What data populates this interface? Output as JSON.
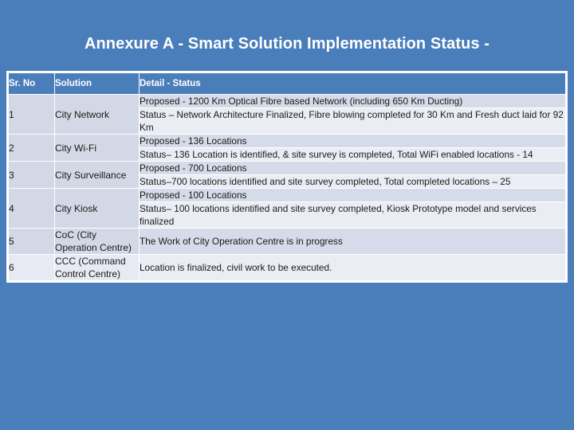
{
  "slide": {
    "title": "Annexure A - Smart Solution Implementation Status -",
    "background_color": "#4a7ebb"
  },
  "table": {
    "headers": {
      "sr_no": "Sr. No",
      "solution": "Solution",
      "detail_status": "Detail - Status"
    },
    "header_background": "#4a7ebb",
    "header_text_color": "#ffffff",
    "rows": [
      {
        "sr_no": "1",
        "solution": "City Network",
        "proposed": "Proposed - 1200 Km Optical Fibre based Network (including  650 Km Ducting)",
        "status": "Status –  Network Architecture Finalized, Fibre blowing completed for 30 Km  and Fresh duct laid for 92 Km"
      },
      {
        "sr_no": "2",
        "solution": "City Wi-Fi",
        "proposed": "Proposed - 136 Locations",
        "status": "Status– 136 Location is identified, & site survey is completed, Total  WiFi enabled locations - 14"
      },
      {
        "sr_no": "3",
        "solution": "City Surveillance",
        "proposed": "Proposed - 700 Locations",
        "status": "Status–700 locations identified and site survey completed, Total completed locations – 25"
      },
      {
        "sr_no": "4",
        "solution": "City Kiosk",
        "proposed": "Proposed - 100 Locations",
        "status": "Status– 100 locations identified and site survey completed, Kiosk Prototype model and services finalized"
      },
      {
        "sr_no": "5",
        "solution": "CoC (City Operation Centre)",
        "detail": "The Work of City Operation Centre is in progress"
      },
      {
        "sr_no": "6",
        "solution": "CCC (Command Control Centre)",
        "detail": "Location is finalized, civil work to be executed."
      }
    ]
  }
}
